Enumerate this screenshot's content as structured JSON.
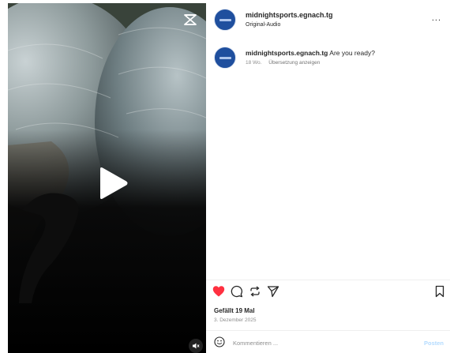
{
  "post": {
    "account_name": "midnightsports.egnach.tg",
    "audio_label": "Original-Audio",
    "more_label": "...",
    "caption_text": "Are you ready?",
    "caption_age": "18 Wo.",
    "translate_label": "Übersetzung anzeigen",
    "likes_text": "Gefällt 19 Mal",
    "date_text": "3. Dezember 2025",
    "comment_placeholder": "Kommentieren ...",
    "post_label": "Posten"
  },
  "colors": {
    "like_red": "#ff3040",
    "post_button": "#b3dbff",
    "avatar_blue": "#1f4f9e"
  },
  "icons": {
    "reel": "reels-icon",
    "play": "play-icon",
    "mute": "speaker-muted-icon",
    "like": "heart-filled-icon",
    "comment": "comment-icon",
    "repost": "repost-icon",
    "share": "send-icon",
    "save": "bookmark-icon",
    "emoji": "emoji-icon"
  }
}
